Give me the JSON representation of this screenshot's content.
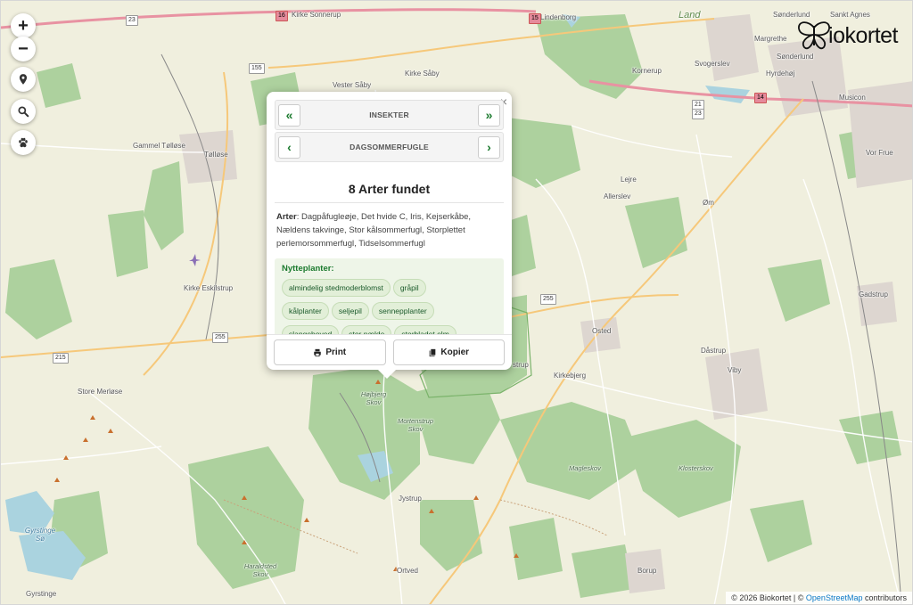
{
  "brand": {
    "name": "iokortet",
    "icon": "butterfly-icon"
  },
  "controls": [
    {
      "name": "zoom-in-button",
      "glyph": "+",
      "icon": "plus-icon"
    },
    {
      "name": "zoom-out-button",
      "glyph": "−",
      "icon": "minus-icon"
    },
    {
      "name": "location-button",
      "icon": "location-pin-icon"
    },
    {
      "name": "search-button",
      "icon": "search-icon"
    },
    {
      "name": "paw-button",
      "icon": "paw-icon"
    }
  ],
  "map": {
    "places": {
      "kirke_sonnerup": "Kirke Sonnerup",
      "lindenborg": "Lindenborg",
      "sonderlund1": "Sønderlund",
      "sankt_agnes": "Sankt Agnes",
      "margrethe": "Margrethe",
      "sonderlund2": "Sønderlund",
      "kornerup": "Kornerup",
      "svogerslev": "Svogerslev",
      "hyrdehoj": "Hyrdehøj",
      "vester_saby": "Vester Såby",
      "kirke_saby": "Kirke Såby",
      "musicon": "Musicon",
      "gammel_tollose": "Gammel Tølløse",
      "tollose": "Tølløse",
      "lejre": "Lejre",
      "allerslev": "Allerslev",
      "vor_frue": "Vor Frue",
      "om": "Øm",
      "kirke_eskilstrup": "Kirke Eskilstrup",
      "gadstrup": "Gadstrup",
      "osted": "Osted",
      "dastrup": "Dåstrup",
      "store_merlose": "Store Merløse",
      "kirkebjerg": "Kirkebjerg",
      "viby": "Viby",
      "hojbjerg_skov": "Højbjerg Skov",
      "mortenstrup_skov": "Mortenstrup Skov",
      "magleskov": "Magleskov",
      "klosterskov": "Klosterskov",
      "jystrup": "Jystrup",
      "gyrstinge_so": "Gyrstinge Sø",
      "haraldsted_skov": "Haraldsted Skov",
      "ortved": "Ortved",
      "borup": "Borup",
      "gyrstinge": "Gyrstinge",
      "land": "Land",
      "strup": "strup"
    },
    "roads": {
      "r23": "23",
      "r155": "155",
      "r16": "16",
      "r15": "15",
      "r21_23a": "21",
      "r21_23b": "23",
      "r14": "14",
      "r255a": "255",
      "r255b": "255",
      "r215": "215"
    }
  },
  "popup": {
    "close_label": "×",
    "nav1": {
      "prev": "«",
      "title": "INSEKTER",
      "next": "»"
    },
    "nav2": {
      "prev": "‹",
      "title": "DAGSOMMERFUGLE",
      "next": "›"
    },
    "count": "8 Arter fundet",
    "species_label": "Arter",
    "species_text": ": Dagpåfugleøje, Det hvide C, Iris, Kejserkåbe, Nældens takvinge, Stor kålsommerfugl, Storplettet perlemorsommerfugl, Tidselsommerfugl",
    "plants_title": "Nytteplanter:",
    "plants": [
      "almindelig stedmoderblomst",
      "gråpil",
      "kålplanter",
      "seljepil",
      "sennepplanter",
      "slangehoved",
      "stor nælde",
      "storbladet elm"
    ],
    "print_label": "Print",
    "copy_label": "Kopier",
    "print_icon": "printer-icon",
    "copy_icon": "copy-icon"
  },
  "attribution": {
    "prefix": "© 2026 Biokortet | © ",
    "link": "OpenStreetMap",
    "suffix": " contributors"
  },
  "colors": {
    "land": "#f2efe6",
    "forest": "#add19e",
    "water": "#aad3df",
    "motorway": "#e892a2",
    "primary_road": "#f6c87a",
    "accent_green": "#1b7a2e"
  }
}
